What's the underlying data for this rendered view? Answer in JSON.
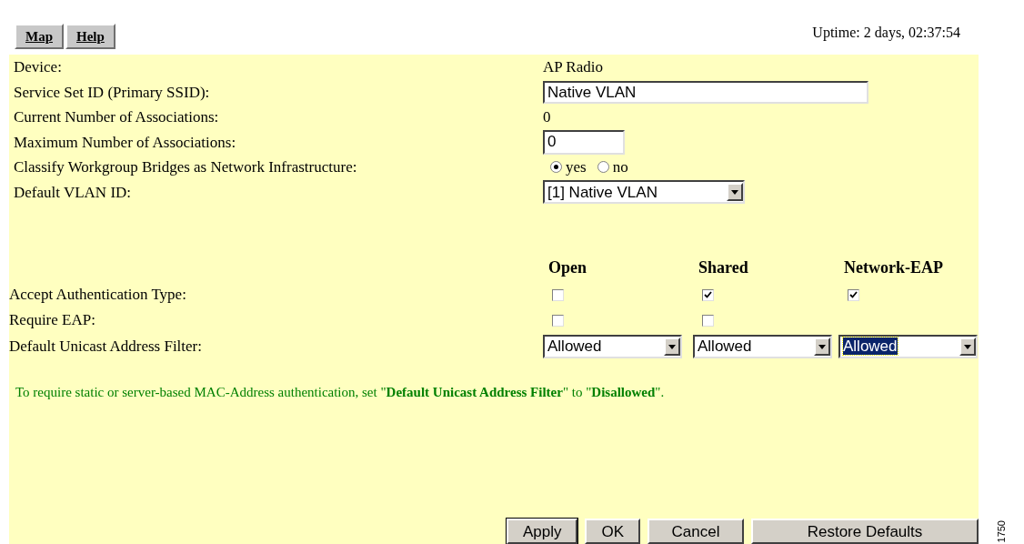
{
  "nav_buttons": [
    "Map",
    "Help"
  ],
  "uptime": "Uptime: 2 days, 02:37:54",
  "device": {
    "label": "Device:",
    "value": "AP Radio"
  },
  "ssid": {
    "label": "Service Set ID (Primary SSID):",
    "value": "Native VLAN"
  },
  "current_associations": {
    "label": "Current Number of Associations:",
    "value": "0"
  },
  "max_associations": {
    "label": "Maximum Number of Associations:",
    "value": "0"
  },
  "classify_wgb": {
    "label": "Classify Workgroup Bridges as Network Infrastructure:",
    "options": [
      {
        "label": "yes",
        "selected": true
      },
      {
        "label": "no",
        "selected": false
      }
    ]
  },
  "default_vlan": {
    "label": "Default VLAN ID:",
    "value": "[1]   Native VLAN"
  },
  "auth_columns": [
    "Open",
    "Shared",
    "Network-EAP"
  ],
  "accept_auth": {
    "label": "Accept Authentication Type:",
    "checks": [
      {
        "checked": false
      },
      {
        "checked": true
      },
      {
        "checked": true
      }
    ]
  },
  "require_eap": {
    "label": "Require EAP:",
    "checks": [
      {
        "checked": false
      },
      {
        "checked": false
      }
    ]
  },
  "unicast_filter": {
    "label": "Default Unicast Address Filter:",
    "selects": [
      {
        "value": "Allowed",
        "focused": false
      },
      {
        "value": "Allowed",
        "focused": false
      },
      {
        "value": "Allowed",
        "focused": true
      }
    ]
  },
  "note": "To require static or server-based MAC-Address authentication, set \"**Default Unicast Address Filter**\" to \"**Disallowed**\".",
  "buttons": [
    {
      "label": "Apply",
      "default": true
    },
    {
      "label": "OK",
      "default": false
    },
    {
      "label": "Cancel",
      "default": false
    },
    {
      "label": "Restore Defaults",
      "default": false
    }
  ],
  "figure_number": "1750"
}
